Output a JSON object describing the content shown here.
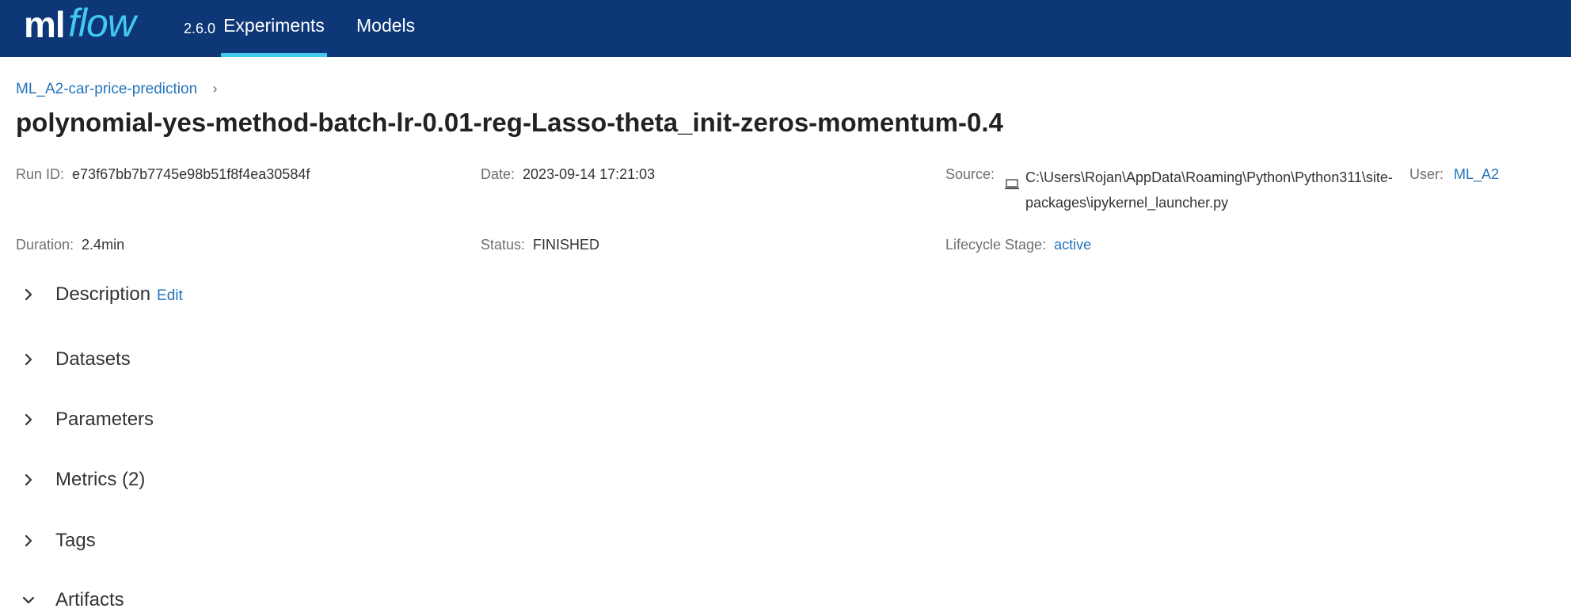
{
  "header": {
    "logo_primary": "ml",
    "logo_secondary": "flow",
    "version": "2.6.0",
    "nav": [
      {
        "label": "Experiments",
        "active": true
      },
      {
        "label": "Models",
        "active": false
      }
    ]
  },
  "breadcrumb": {
    "experiment": "ML_A2-car-price-prediction",
    "separator": "›"
  },
  "run": {
    "title": "polynomial-yes-method-batch-lr-0.01-reg-Lasso-theta_init-zeros-momentum-0.4",
    "run_id_label": "Run ID:",
    "run_id": "e73f67bb7b7745e98b51f8f4ea30584f",
    "date_label": "Date:",
    "date": "2023-09-14 17:21:03",
    "source_label": "Source:",
    "source_icon": "laptop-icon",
    "source": "C:\\Users\\Rojan\\AppData\\Roaming\\Python\\Python311\\site-packages\\ipykernel_launcher.py",
    "user_label": "User:",
    "user": "ML_A2",
    "duration_label": "Duration:",
    "duration": "2.4min",
    "status_label": "Status:",
    "status": "FINISHED",
    "lifecycle_label": "Lifecycle Stage:",
    "lifecycle": "active"
  },
  "sections": {
    "description": {
      "label": "Description",
      "edit_label": "Edit",
      "expanded": false
    },
    "datasets": {
      "label": "Datasets",
      "expanded": false
    },
    "parameters": {
      "label": "Parameters",
      "expanded": false
    },
    "metrics": {
      "label": "Metrics (2)",
      "expanded": false
    },
    "tags": {
      "label": "Tags",
      "expanded": false
    },
    "artifacts": {
      "label": "Artifacts",
      "expanded": true
    }
  },
  "colors": {
    "header_bg": "#0d3776",
    "accent": "#43c9ed",
    "link": "#2374bb"
  }
}
